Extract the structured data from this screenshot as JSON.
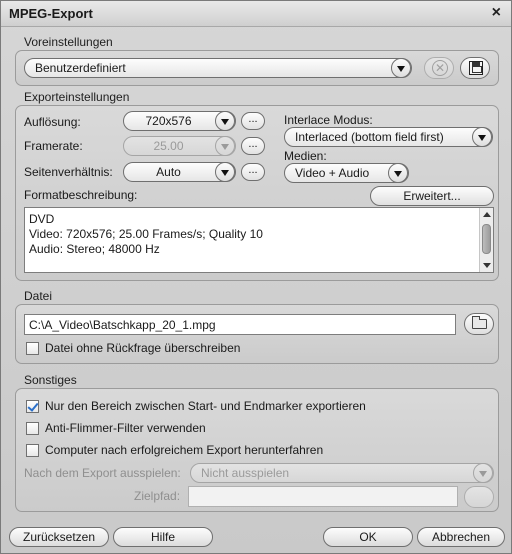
{
  "window": {
    "title": "MPEG-Export",
    "close_glyph": "×"
  },
  "presets": {
    "section": "Voreinstellungen",
    "selected": "Benutzerdefiniert",
    "delete_icon": "delete-icon",
    "save_icon": "save-icon"
  },
  "export": {
    "section": "Exporteinstellungen",
    "resolution_label": "Auflösung:",
    "resolution_value": "720x576",
    "framerate_label": "Framerate:",
    "framerate_value": "25.00",
    "aspect_label": "Seitenverhältnis:",
    "aspect_value": "Auto",
    "more_label": "...",
    "interlace_label": "Interlace Modus:",
    "interlace_value": "Interlaced (bottom field first)",
    "media_label": "Medien:",
    "media_value": "Video + Audio",
    "format_label": "Formatbeschreibung:",
    "advanced_button": "Erweitert...",
    "description_lines": [
      "DVD",
      "Video: 720x576; 25.00 Frames/s; Quality 10",
      "Audio: Stereo; 48000 Hz"
    ]
  },
  "file": {
    "section": "Datei",
    "path": "C:\\A_Video\\Batschkapp_20_1.mpg",
    "overwrite_label": "Datei ohne Rückfrage überschreiben",
    "overwrite_checked": false
  },
  "misc": {
    "section": "Sonstiges",
    "range_label": "Nur den Bereich zwischen Start- und Endmarker exportieren",
    "range_checked": true,
    "antiflicker_label": "Anti-Flimmer-Filter verwenden",
    "antiflicker_checked": false,
    "shutdown_label": "Computer nach erfolgreichem Export herunterfahren",
    "shutdown_checked": false,
    "playback_label": "Nach dem Export ausspielen:",
    "playback_value": "Nicht ausspielen",
    "target_label": "Zielpfad:",
    "target_value": ""
  },
  "buttons": {
    "reset": "Zurücksetzen",
    "help": "Hilfe",
    "ok": "OK",
    "cancel": "Abbrechen"
  }
}
